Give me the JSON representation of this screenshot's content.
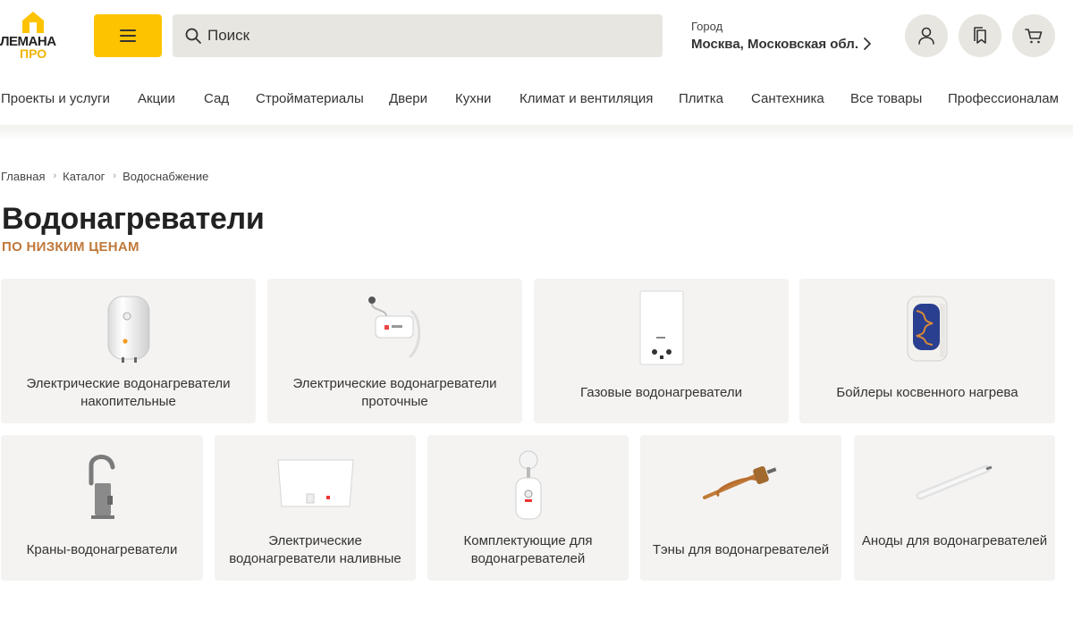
{
  "logo": {
    "top": "ЛЕМАНА",
    "bottom": "ПРО"
  },
  "search": {
    "placeholder": "Поиск"
  },
  "city": {
    "label": "Город",
    "value": "Москва, Московская обл."
  },
  "nav": [
    "Проекты и услуги",
    "Акции",
    "Сад",
    "Стройматериалы",
    "Двери",
    "Кухни",
    "Климат и вентиляция",
    "Плитка",
    "Сантехника",
    "Все товары",
    "Профессионалам"
  ],
  "breadcrumb": [
    "Главная",
    "Каталог",
    "Водоснабжение"
  ],
  "page": {
    "title": "Водонагреватели",
    "subtitle": "ПО НИЗКИМ ЦЕНАМ"
  },
  "categories": [
    {
      "label": "Электрические водонагреватели накопительные",
      "icon": "storage-water-heater"
    },
    {
      "label": "Электрические водонагреватели проточные",
      "icon": "instant-water-heater"
    },
    {
      "label": "Газовые водонагреватели",
      "icon": "gas-water-heater"
    },
    {
      "label": "Бойлеры косвенного нагрева",
      "icon": "indirect-boiler"
    },
    {
      "label": "Краны-водонагреватели",
      "icon": "heating-tap"
    },
    {
      "label": "Электрические водонагреватели наливные",
      "icon": "bulk-water-heater"
    },
    {
      "label": "Комплектующие для водонагревателей",
      "icon": "water-heater-parts"
    },
    {
      "label": "Тэны для водонагревателей",
      "icon": "heating-element"
    },
    {
      "label": "Аноды для водонагревателей",
      "icon": "anode-rod"
    }
  ],
  "colors": {
    "accent": "#fdc300",
    "subtitle": "#c0783a",
    "card_bg": "#f4f3f1",
    "control_bg": "#e8e6e0"
  }
}
